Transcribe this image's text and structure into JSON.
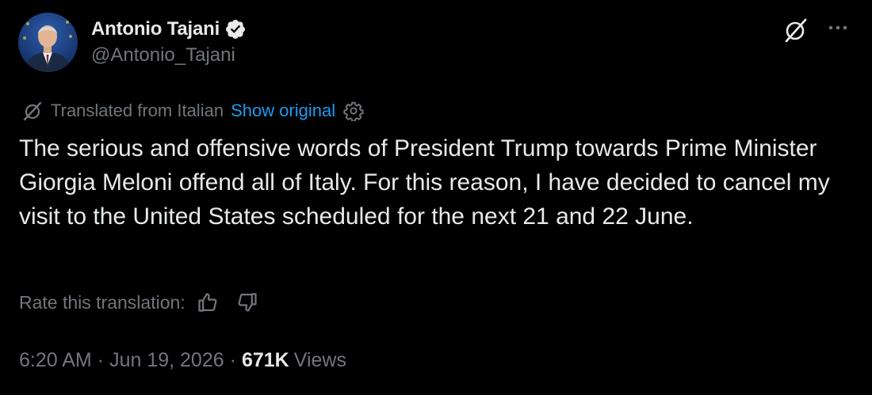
{
  "author": {
    "display_name": "Antonio Tajani",
    "handle": "@Antonio_Tajani",
    "verified": true
  },
  "icons": {
    "verified": "verified-badge-icon",
    "grok": "grok-icon",
    "more": "more-icon",
    "translate": "translate-icon",
    "settings": "gear-icon",
    "thumbs_up": "thumbs-up-icon",
    "thumbs_down": "thumbs-down-icon"
  },
  "translation": {
    "label": "Translated from Italian",
    "show_original": "Show original"
  },
  "tweet": {
    "text": "The serious and offensive words of President Trump towards Prime Minister Giorgia Meloni offend all of Italy. For this reason, I have decided to cancel my visit to the United States scheduled for the next 21 and 22 June."
  },
  "rate": {
    "label": "Rate this translation:"
  },
  "meta": {
    "time": "6:20 AM",
    "separator": "·",
    "date": "Jun 19, 2026",
    "views_count": "671K",
    "views_label": "Views"
  },
  "colors": {
    "background": "#000000",
    "primary_text": "#e7e9ea",
    "secondary_text": "#71767b",
    "link": "#1d9bf0"
  }
}
